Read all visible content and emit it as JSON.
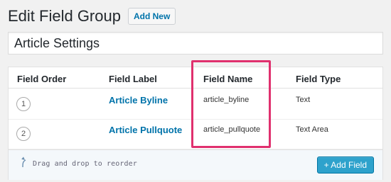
{
  "header": {
    "title": "Edit Field Group",
    "add_new_label": "Add New"
  },
  "group_title": {
    "value": "Article Settings"
  },
  "table": {
    "columns": [
      "Field Order",
      "Field Label",
      "Field Name",
      "Field Type"
    ],
    "rows": [
      {
        "order": "1",
        "label": "Article Byline",
        "name": "article_byline",
        "type": "Text"
      },
      {
        "order": "2",
        "label": "Article Pullquote",
        "name": "article_pullquote",
        "type": "Text Area"
      }
    ]
  },
  "footer": {
    "reorder_hint": "Drag and drop to reorder",
    "add_field_label": "+ Add Field"
  },
  "colors": {
    "link": "#0073aa",
    "primary_button": "#2ea2cc",
    "highlight": "#e0306e",
    "background": "#f1f1f1"
  },
  "icons": {
    "reorder": "curved-arrow-up-icon"
  }
}
